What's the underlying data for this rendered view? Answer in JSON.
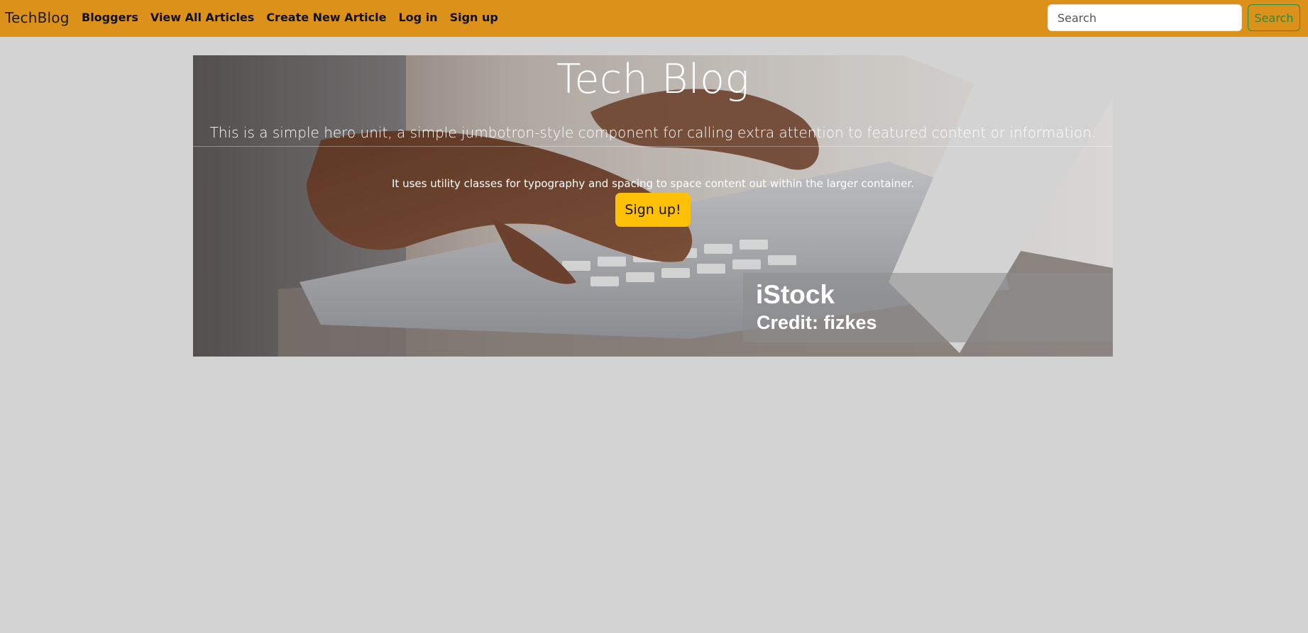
{
  "navbar": {
    "brand": "TechBlog",
    "links": [
      "Bloggers",
      "View All Articles",
      "Create New Article",
      "Log in",
      "Sign up"
    ],
    "search_placeholder": "Search",
    "search_button": "Search",
    "background_color": "#dc911b",
    "search_button_color": "#2b8a3e"
  },
  "hero": {
    "title": "Tech Blog",
    "lead": "This is a simple hero unit, a simple jumbotron-style component for calling extra attention to featured content or information.",
    "text": "It uses utility classes for typography and spacing to space content out within the larger container.",
    "button_label": "Sign up!",
    "button_color": "#ffc107",
    "watermark_logo": "iStock",
    "watermark_credit": "Credit: fizkes"
  },
  "page": {
    "background_color": "#d3d3d3"
  }
}
